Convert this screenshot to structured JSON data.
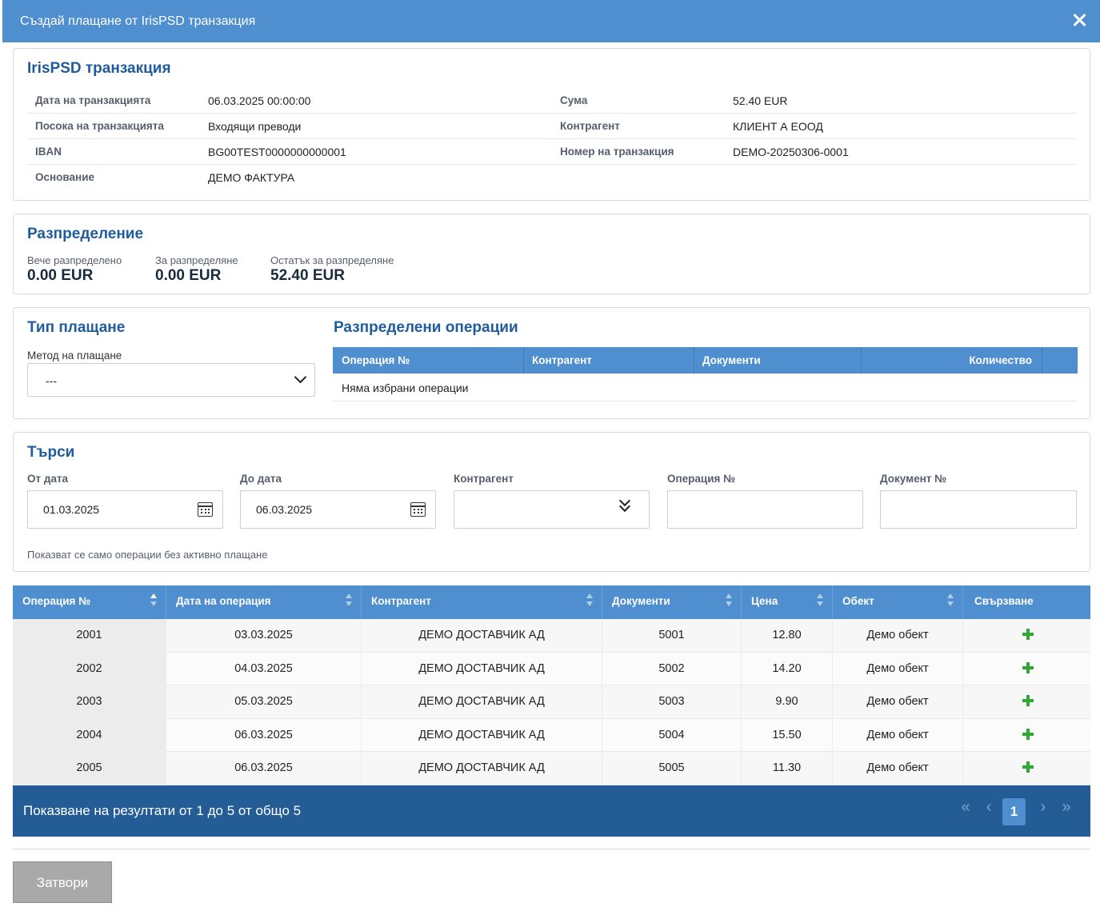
{
  "dialog": {
    "title": "Създай плащане от IrisPSD транзакция"
  },
  "transaction": {
    "title": "IrisPSD транзакция",
    "rows": [
      {
        "label1": "Дата на транзакцията",
        "value1": "06.03.2025 00:00:00",
        "label2": "Сума",
        "value2": "52.40 EUR"
      },
      {
        "label1": "Посока на транзакцията",
        "value1": "Входящи преводи",
        "label2": "Контрагент",
        "value2": "КЛИЕНТ А ЕООД"
      },
      {
        "label1": "IBAN",
        "value1": "BG00TEST0000000000001",
        "label2": "Номер на транзакция",
        "value2": "DEMO-20250306-0001"
      },
      {
        "label1": "Основание",
        "value1": "ДЕМО ФАКТУРА",
        "label2": "",
        "value2": ""
      }
    ]
  },
  "distribution": {
    "title": "Разпределение",
    "already_label": "Вече разпределено",
    "already_value": "0.00 EUR",
    "to_label": "За разпределяне",
    "to_value": "0.00 EUR",
    "remaining_label": "Остатък за разпределяне",
    "remaining_value": "52.40 EUR"
  },
  "payment_type": {
    "title": "Тип плащане",
    "method_label": "Метод на плащане",
    "method_value": "---"
  },
  "distributed_ops": {
    "title": "Разпределени операции",
    "columns": [
      "Операция №",
      "Контрагент",
      "Документи",
      "Количество"
    ],
    "empty_text": "Няма избрани операции"
  },
  "search": {
    "title": "Търси",
    "from_label": "От дата",
    "from_value": "01.03.2025",
    "to_label": "До дата",
    "to_value": "06.03.2025",
    "contractor_label": "Контрагент",
    "operation_label": "Операция №",
    "document_label": "Документ №",
    "hint": "Показват се само операции без активно плащане"
  },
  "results": {
    "columns": [
      "Операция №",
      "Дата на операция",
      "Контрагент",
      "Документи",
      "Цена",
      "Обект",
      "Свързване"
    ],
    "rows": [
      {
        "op": "2001",
        "date": "03.03.2025",
        "contractor": "ДЕМО ДОСТАВЧИК АД",
        "doc": "5001",
        "price": "12.80",
        "object": "Демо обект"
      },
      {
        "op": "2002",
        "date": "04.03.2025",
        "contractor": "ДЕМО ДОСТАВЧИК АД",
        "doc": "5002",
        "price": "14.20",
        "object": "Демо обект"
      },
      {
        "op": "2003",
        "date": "05.03.2025",
        "contractor": "ДЕМО ДОСТАВЧИК АД",
        "doc": "5003",
        "price": "9.90",
        "object": "Демо обект"
      },
      {
        "op": "2004",
        "date": "06.03.2025",
        "contractor": "ДЕМО ДОСТАВЧИК АД",
        "doc": "5004",
        "price": "15.50",
        "object": "Демо обект"
      },
      {
        "op": "2005",
        "date": "06.03.2025",
        "contractor": "ДЕМО ДОСТАВЧИК АД",
        "doc": "5005",
        "price": "11.30",
        "object": "Демо обект"
      }
    ],
    "link_icon": "plus-icon"
  },
  "pager": {
    "summary": "Показване на резултати от 1 до 5 от общо 5",
    "first": "«",
    "prev": "‹",
    "current": "1",
    "next": "›",
    "last": "»"
  },
  "footer": {
    "close_label": "Затвори"
  },
  "colors": {
    "header": "#4f8ecf",
    "pager": "#245d95",
    "accent_title": "#1f5c9e",
    "plus": "#2fa836"
  }
}
